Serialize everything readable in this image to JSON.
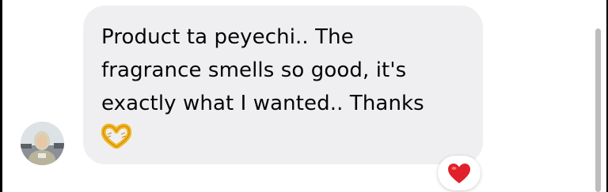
{
  "message": {
    "lines": [
      "Product ta peyechi.. The",
      "fragrance smells so good, it's",
      "exactly what I wanted.. Thanks"
    ],
    "emoji": "heart-hands-emoji"
  },
  "reaction": {
    "emoji": "red-heart-icon",
    "color": "#e0202a"
  },
  "colors": {
    "bubble": "#efeff1",
    "text": "#050505",
    "scrollbar": "#bdbdbd"
  }
}
